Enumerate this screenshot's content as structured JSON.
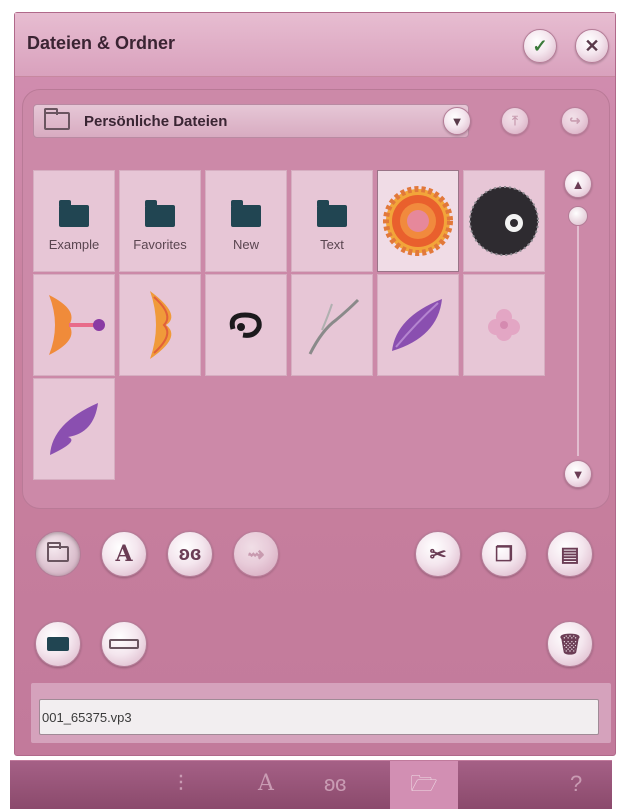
{
  "dialog": {
    "title": "Dateien & Ordner",
    "confirm_icon": "check-icon",
    "close_icon": "close-icon"
  },
  "browser": {
    "current_folder": "Persönliche Dateien",
    "items": [
      {
        "type": "folder",
        "label": "Example"
      },
      {
        "type": "folder",
        "label": "Favorites"
      },
      {
        "type": "folder",
        "label": "New"
      },
      {
        "type": "folder",
        "label": "Text"
      },
      {
        "type": "design",
        "icon": "flower-design-thumbnail",
        "selected": true
      },
      {
        "type": "design",
        "icon": "lace-circle-design-thumbnail"
      },
      {
        "type": "design",
        "icon": "butterfly-half-design-thumbnail"
      },
      {
        "type": "design",
        "icon": "wing-design-thumbnail"
      },
      {
        "type": "design",
        "icon": "swirl-design-thumbnail"
      },
      {
        "type": "design",
        "icon": "branch-design-thumbnail"
      },
      {
        "type": "design",
        "icon": "purple-leaf-design-thumbnail"
      },
      {
        "type": "design",
        "icon": "pink-flower-design-thumbnail"
      },
      {
        "type": "design",
        "icon": "purple-feather-design-thumbnail"
      }
    ]
  },
  "filters": [
    "folder-icon",
    "font-icon",
    "butterfly-icon",
    "usb-icon"
  ],
  "actions": [
    "scissors-icon",
    "copy-icon",
    "paste-icon"
  ],
  "filename": "001_65375.vp3",
  "colors": {
    "accent": "#c9819f",
    "title_bar": "#e0b0c7",
    "bottom_bar": "#8b4a6c"
  }
}
